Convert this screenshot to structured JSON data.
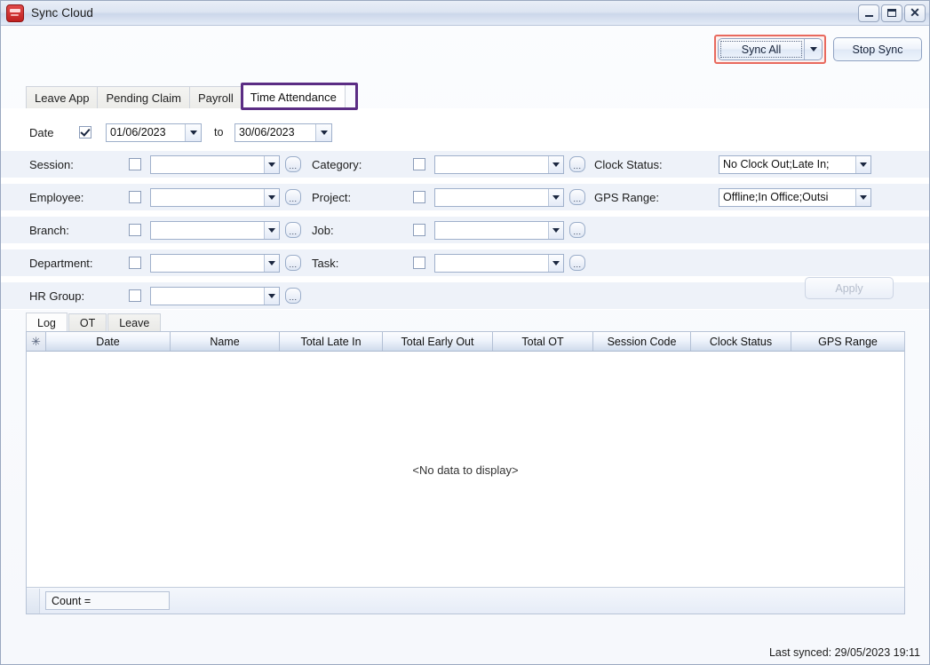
{
  "window": {
    "title": "Sync Cloud",
    "icon": "app-logo-icon",
    "minimize": "–",
    "maximize": "▫",
    "close": "✕"
  },
  "toolbar": {
    "sync_all_label": "Sync All",
    "sync_all_dropdown": "▼",
    "stop_sync_label": "Stop Sync"
  },
  "tabs": [
    {
      "label": "Leave App",
      "active": false
    },
    {
      "label": "Pending Claim",
      "active": false
    },
    {
      "label": "Payroll",
      "active": false
    },
    {
      "label": "Time Attendance",
      "active": true
    }
  ],
  "filters": {
    "date": {
      "label": "Date",
      "enabled": true,
      "from": "01/06/2023",
      "to": "30/06/2023",
      "to_label": "to"
    },
    "left_column": [
      {
        "label": "Session:",
        "checked": false,
        "value": ""
      },
      {
        "label": "Employee:",
        "checked": false,
        "value": ""
      },
      {
        "label": "Branch:",
        "checked": false,
        "value": ""
      },
      {
        "label": "Department:",
        "checked": false,
        "value": ""
      },
      {
        "label": "HR Group:",
        "checked": false,
        "value": ""
      }
    ],
    "middle_column": [
      {
        "label": "Category:",
        "checked": false,
        "value": ""
      },
      {
        "label": "Project:",
        "checked": false,
        "value": ""
      },
      {
        "label": "Job:",
        "checked": false,
        "value": ""
      },
      {
        "label": "Task:",
        "checked": false,
        "value": ""
      }
    ],
    "right_column": [
      {
        "label": "Clock Status:",
        "value": "No Clock Out;Late In;"
      },
      {
        "label": "GPS Range:",
        "value": "Offline;In Office;Outsi"
      }
    ],
    "apply_label": "Apply"
  },
  "grid": {
    "tabs": [
      {
        "label": "Log",
        "active": true
      },
      {
        "label": "OT",
        "active": false
      },
      {
        "label": "Leave",
        "active": false
      }
    ],
    "row_indicator": "✳",
    "columns": [
      "Date",
      "Name",
      "Total Late In",
      "Total Early Out",
      "Total OT",
      "Session Code",
      "Clock Status",
      "GPS Range"
    ],
    "rows": [],
    "empty_message": "<No data to display>",
    "count_label": "Count ="
  },
  "status": {
    "last_synced": "Last synced: 29/05/2023 19:11"
  },
  "colors": {
    "highlight_tab": "#5b2d84",
    "highlight_button": "#e8695e",
    "titlebar": "#dde5f2",
    "accent": "#1b2740"
  }
}
